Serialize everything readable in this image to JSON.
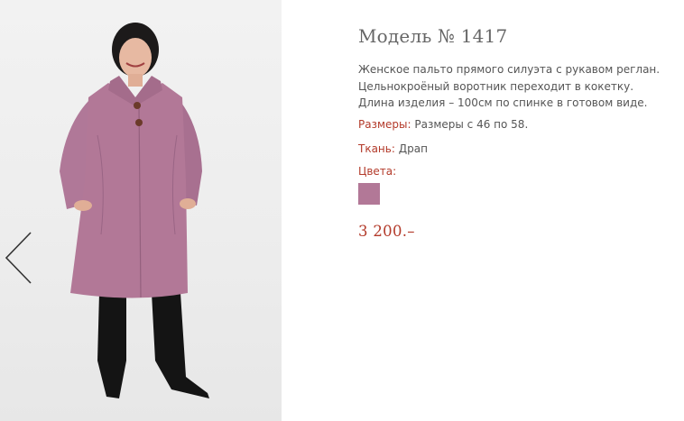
{
  "product": {
    "title": "Модель № 1417",
    "description": "Женское пальто прямого силуэта с рукавом реглан. Цельнокроёный воротник переходит в кокетку. Длина изделия –  100см по спинке в готовом виде.",
    "sizes_label": "Размеры:",
    "sizes_value": " Размеры с 46 по 58.",
    "fabric_label": "Ткань:",
    "fabric_value": " Драп",
    "colors_label": "Цвета:",
    "price": "3 200.–"
  },
  "colors": {
    "accent": "#b33a2a",
    "swatch": "#b27897",
    "text": "#555555"
  },
  "gallery": {
    "prev_icon": "chevron-left-icon"
  }
}
